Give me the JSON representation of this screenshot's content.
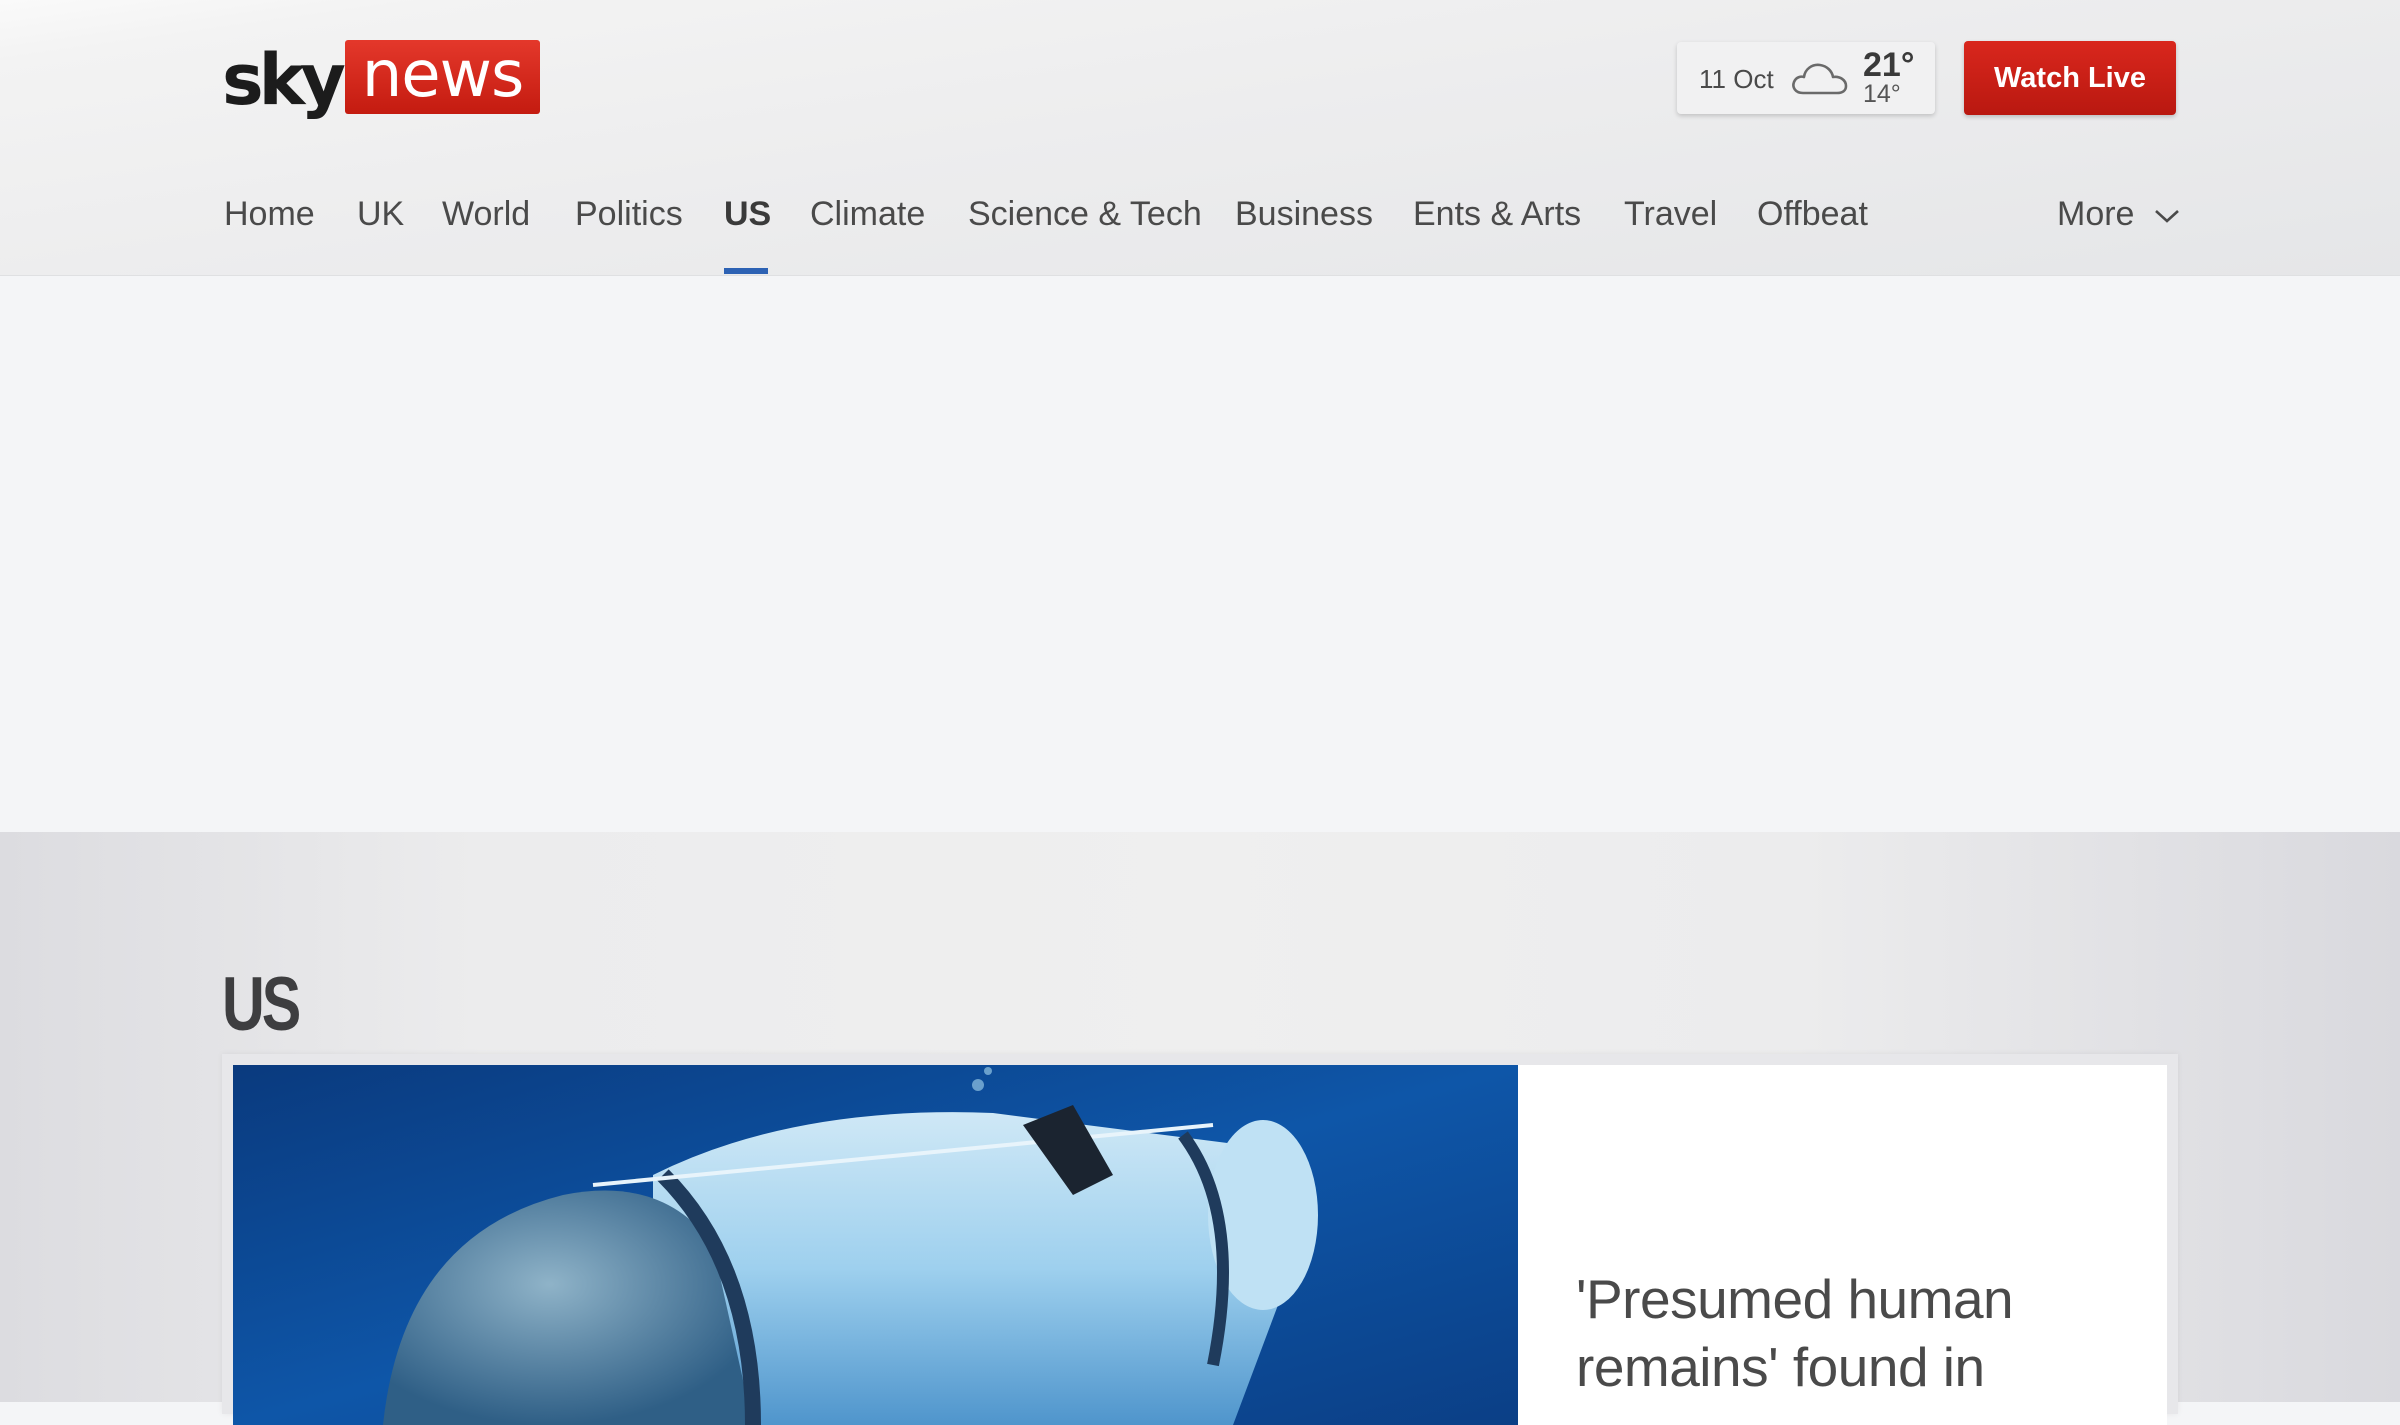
{
  "header": {
    "logo": {
      "sky": "sky",
      "news": "news"
    },
    "weather": {
      "date": "11 Oct",
      "icon": "cloud-icon",
      "high": "21°",
      "low": "14°"
    },
    "watch_live_label": "Watch Live"
  },
  "nav": {
    "items": [
      {
        "label": "Home"
      },
      {
        "label": "UK"
      },
      {
        "label": "World"
      },
      {
        "label": "Politics"
      },
      {
        "label": "US",
        "active": true
      },
      {
        "label": "Climate"
      },
      {
        "label": "Science & Tech"
      },
      {
        "label": "Business"
      },
      {
        "label": "Ents & Arts"
      },
      {
        "label": "Travel"
      },
      {
        "label": "Offbeat"
      }
    ],
    "more_label": "More"
  },
  "section": {
    "title": "US",
    "lead_story": {
      "headline": "'Presumed human remains' found in",
      "image": "submersible-photo"
    }
  },
  "colors": {
    "brand_red": "#d9271d",
    "nav_active": "#2d62b4",
    "text": "#4a4a4a"
  }
}
